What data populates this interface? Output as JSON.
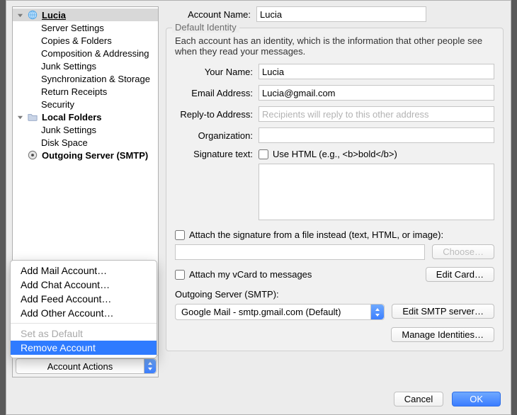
{
  "sidebar": {
    "account_name": "Lucia",
    "account_items": [
      "Server Settings",
      "Copies & Folders",
      "Composition & Addressing",
      "Junk Settings",
      "Synchronization & Storage",
      "Return Receipts",
      "Security"
    ],
    "local_label": "Local Folders",
    "local_items": [
      "Junk Settings",
      "Disk Space"
    ],
    "outgoing_label": "Outgoing Server (SMTP)",
    "actions_label": "Account Actions"
  },
  "context_menu": {
    "items": [
      "Add Mail Account…",
      "Add Chat Account…",
      "Add Feed Account…",
      "Add Other Account…"
    ],
    "set_default": "Set as Default",
    "remove": "Remove Account"
  },
  "main": {
    "account_name_label": "Account Name:",
    "account_name_value": "Lucia",
    "section_title": "Default Identity",
    "description": "Each account has an identity, which is the information that other people see when they read your messages.",
    "your_name_label": "Your Name:",
    "your_name_value": "Lucia",
    "email_label": "Email Address:",
    "email_value": "Lucia@gmail.com",
    "reply_label": "Reply-to Address:",
    "reply_placeholder": "Recipients will reply to this other address",
    "org_label": "Organization:",
    "sig_label": "Signature text:",
    "use_html_label": "Use HTML (e.g., <b>bold</b>)",
    "attach_file_label": "Attach the signature from a file instead (text, HTML, or image):",
    "choose_label": "Choose…",
    "attach_vcard_label": "Attach my vCard to messages",
    "edit_card_label": "Edit Card…",
    "outgoing_label": "Outgoing Server (SMTP):",
    "outgoing_value": "Google Mail - smtp.gmail.com (Default)",
    "edit_smtp_label": "Edit SMTP server…",
    "manage_identities_label": "Manage Identities…"
  },
  "footer": {
    "cancel": "Cancel",
    "ok": "OK"
  }
}
